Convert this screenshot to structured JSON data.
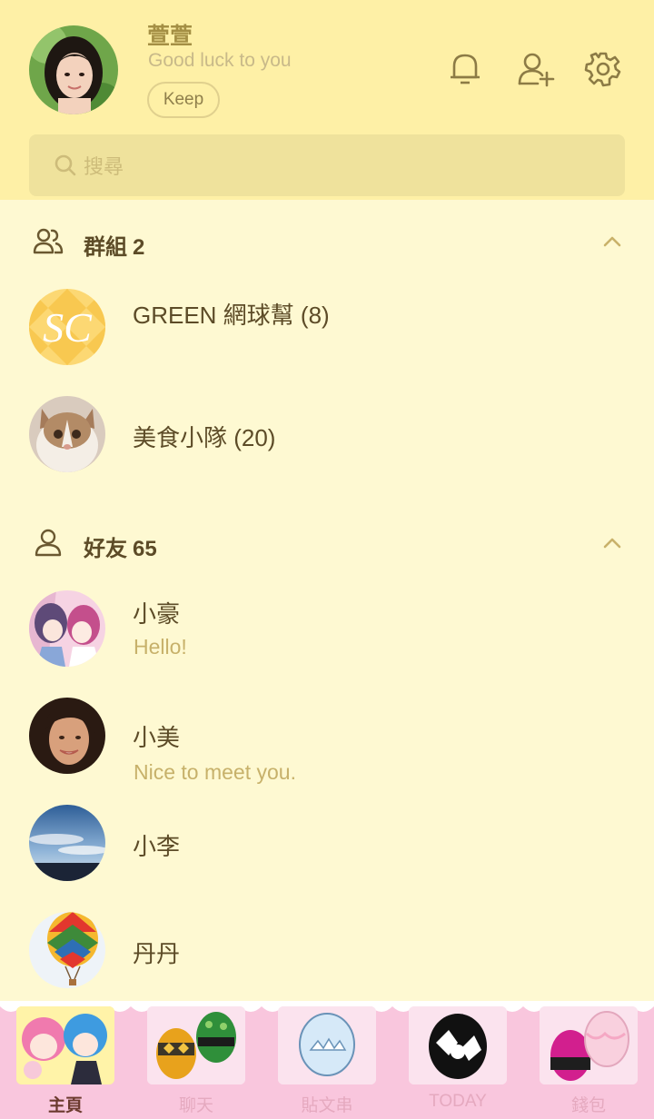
{
  "profile": {
    "name": "萱萱",
    "status": "Good luck to you",
    "keep_label": "Keep"
  },
  "header_icons": [
    "bell-icon",
    "add-friend-icon",
    "gear-icon"
  ],
  "search": {
    "placeholder": "搜尋"
  },
  "groups": {
    "title": "群組",
    "count": "2",
    "items": [
      {
        "name": "GREEN 網球幫 (8)"
      },
      {
        "name": "美食小隊 (20)"
      }
    ]
  },
  "friends": {
    "title": "好友",
    "count": "65",
    "items": [
      {
        "name": "小豪",
        "message": "Hello!"
      },
      {
        "name": "小美",
        "message": "Nice to meet you."
      },
      {
        "name": "小李",
        "message": ""
      },
      {
        "name": "丹丹",
        "message": ""
      }
    ]
  },
  "nav": {
    "items": [
      {
        "label": "主頁",
        "active": true
      },
      {
        "label": "聊天",
        "active": false
      },
      {
        "label": "貼文串",
        "active": false
      },
      {
        "label": "TODAY",
        "active": false
      },
      {
        "label": "錢包",
        "active": false
      }
    ]
  },
  "colors": {
    "header_bg": "#FEF0A6",
    "page_bg": "#FEF9D2",
    "search_bg": "#EFE29C",
    "text_dark": "#5C4B27",
    "text_accent": "#A48F44",
    "message_text": "#C7B16A",
    "nav_bg": "#F9C6DD"
  }
}
